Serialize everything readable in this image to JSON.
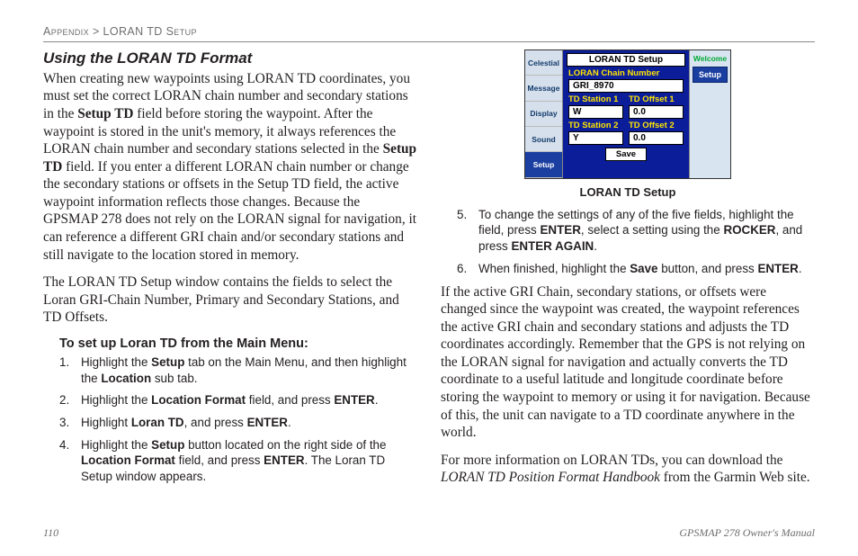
{
  "breadcrumb": {
    "section": "Appendix",
    "sep": ">",
    "sub": "LORAN TD Setup"
  },
  "left": {
    "heading": "Using the LORAN TD Format",
    "p1a": "When creating new waypoints using LORAN TD coordinates, you must set the correct LORAN chain number and secondary stations in the ",
    "p1b": "Setup TD",
    "p1c": " field before storing the waypoint. After the waypoint is stored in the unit's memory, it always references the LORAN chain number and secondary stations selected in the ",
    "p1d": "Setup TD",
    "p1e": " field. If you enter a different LORAN chain number or change the secondary stations or offsets in the Setup TD field, the active waypoint information reflects those changes. Because the GPSMAP 278 does not rely on the LORAN signal for navigation, it can reference a different GRI chain and/or secondary stations and still navigate to the location stored in memory.",
    "p2": "The LORAN TD Setup window contains the fields to select the Loran GRI-Chain Number, Primary and Secondary Stations, and TD Offsets.",
    "h3": "To set up Loran TD from the Main Menu:",
    "steps": [
      {
        "n": "1.",
        "pre": "Highlight the ",
        "b1": "Setup",
        "mid": " tab on the Main Menu, and then highlight the ",
        "b2": "Location",
        "post": " sub tab."
      },
      {
        "n": "2.",
        "pre": "Highlight the ",
        "b1": "Location Format",
        "mid": " field, and press ",
        "b2": "ENTER",
        "post": "."
      },
      {
        "n": "3.",
        "pre": "Highlight ",
        "b1": "Loran TD",
        "mid": ", and press ",
        "b2": "ENTER",
        "post": "."
      },
      {
        "n": "4.",
        "pre": "Highlight the ",
        "b1": "Setup",
        "mid": " button located on the right side of the ",
        "b2": "Location Format",
        "post": " field, and press ",
        "b3": "ENTER",
        "post2": ". The Loran TD Setup window appears."
      }
    ]
  },
  "right": {
    "device": {
      "leftTabs": [
        "Celestial",
        "Message",
        "Display",
        "Sound",
        "Setup"
      ],
      "rtWelcome": "Welcome",
      "rtSetup": "Setup",
      "title": "LORAN TD Setup",
      "chainLabel": "LORAN Chain Number",
      "chainValue": "GRI_8970",
      "st1": "TD Station 1",
      "of1": "TD Offset 1",
      "st1v": "W",
      "of1v": "0.0",
      "st2": "TD Station 2",
      "of2": "TD Offset 2",
      "st2v": "Y",
      "of2v": "0.0",
      "save": "Save"
    },
    "caption": "LORAN TD Setup",
    "steps": [
      {
        "n": "5.",
        "pre": "To change the settings of any of the five fields, highlight the field, press ",
        "b1": "ENTER",
        "mid": ", select a setting using the ",
        "b2": "ROCKER",
        "post": ", and press ",
        "b3": "ENTER AGAIN",
        "post2": "."
      },
      {
        "n": "6.",
        "pre": "When finished, highlight the ",
        "b1": "Save",
        "mid": " button, and press ",
        "b2": "ENTER",
        "post": "."
      }
    ],
    "p1": "If the active GRI Chain, secondary stations, or offsets were changed since the waypoint was created, the waypoint references the active GRI chain and secondary stations and adjusts the TD coordinates accordingly. Remember that the GPS is not relying on the LORAN signal for navigation and actually converts the TD coordinate to a useful latitude and longitude coordinate before storing the waypoint to memory or using it for navigation. Because of this, the unit can navigate to a TD coordinate anywhere in the world.",
    "p2a": "For more information on LORAN TDs, you can download the ",
    "p2i": "LORAN TD Position Format Handbook",
    "p2b": " from the Garmin Web site."
  },
  "footer": {
    "left": "110",
    "right": "GPSMAP 278 Owner's Manual"
  }
}
